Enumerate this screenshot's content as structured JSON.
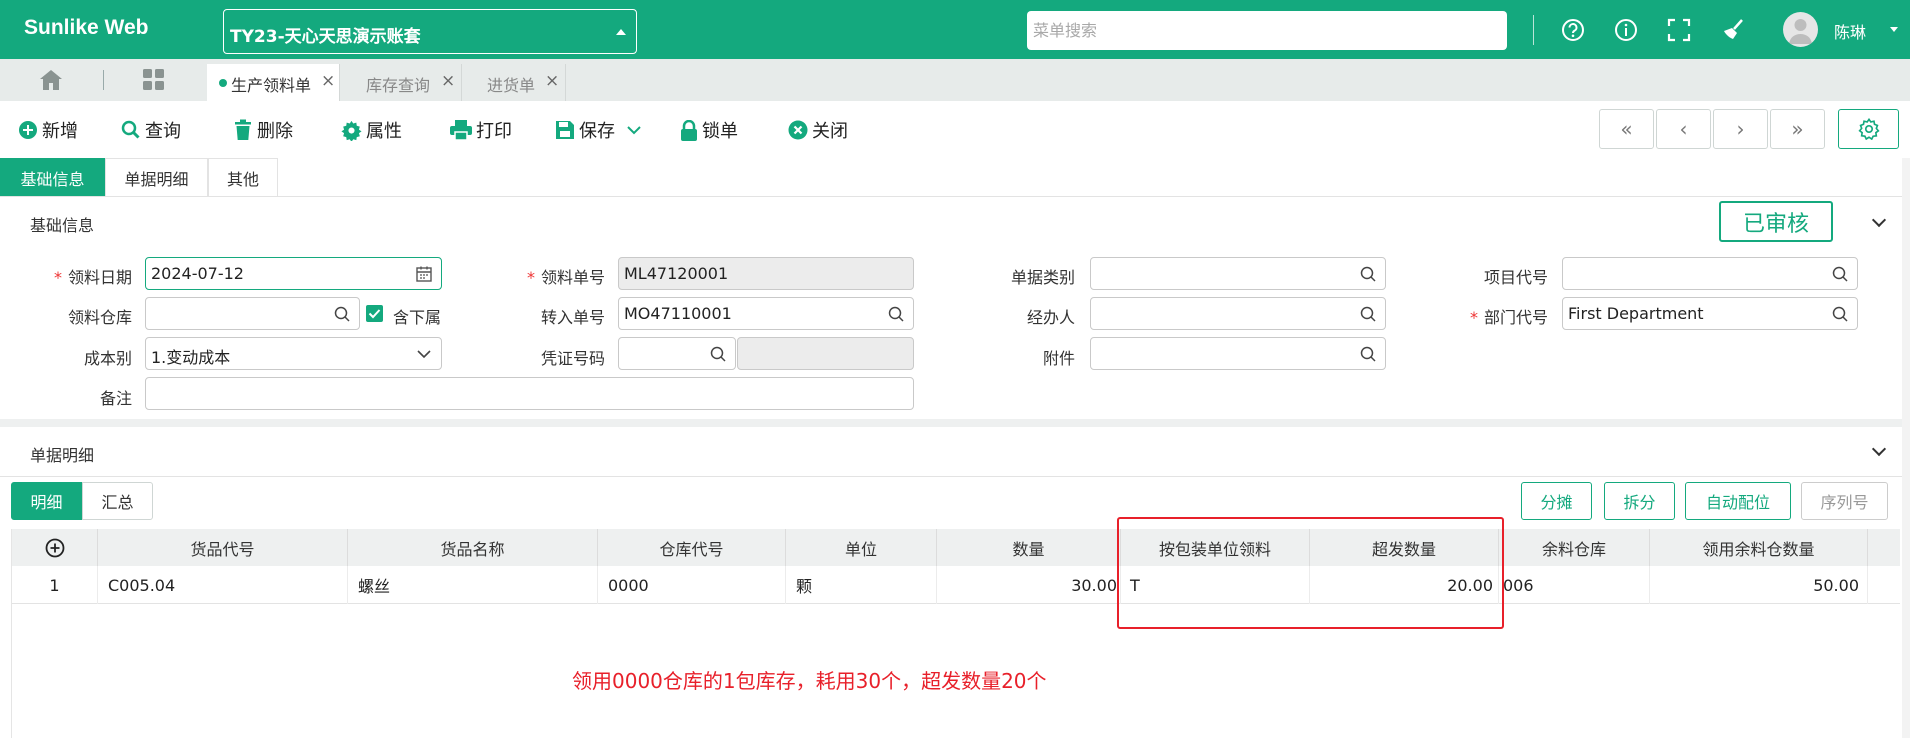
{
  "header": {
    "logo": "Sunlike Web",
    "account": "TY23-天心天思演示账套",
    "search_placeholder": "菜单搜索",
    "user": "陈琳"
  },
  "tabs": [
    {
      "label": "生产领料单",
      "active": true
    },
    {
      "label": "库存查询",
      "active": false
    },
    {
      "label": "进货单",
      "active": false
    }
  ],
  "toolbar": {
    "new": "新增",
    "query": "查询",
    "delete": "删除",
    "properties": "属性",
    "print": "打印",
    "save": "保存",
    "lock": "锁单",
    "close": "关闭"
  },
  "section_tabs": [
    "基础信息",
    "单据明细",
    "其他"
  ],
  "basic": {
    "title": "基础信息",
    "status": "已审核",
    "labels": {
      "issue_date": "领料日期",
      "warehouse": "领料仓库",
      "include_sub": "含下属",
      "cost_type": "成本别",
      "remark": "备注",
      "issue_no": "领料单号",
      "transfer_no": "转入单号",
      "voucher_no": "凭证号码",
      "doc_type": "单据类别",
      "handler": "经办人",
      "attachment": "附件",
      "project_code": "项目代号",
      "dept_code": "部门代号"
    },
    "values": {
      "issue_date": "2024-07-12",
      "cost_type": "1.变动成本",
      "issue_no": "ML47120001",
      "transfer_no": "MO47110001",
      "dept_code": "First Department"
    }
  },
  "detail": {
    "title": "单据明细",
    "sub_tabs": [
      "明细",
      "汇总"
    ],
    "actions": [
      "分摊",
      "拆分",
      "自动配位",
      "序列号"
    ],
    "columns": [
      "货品代号",
      "货品名称",
      "仓库代号",
      "单位",
      "数量",
      "按包装单位领料",
      "超发数量",
      "余料仓库",
      "领用余料仓数量"
    ],
    "rows": [
      {
        "no": "1",
        "code": "C005.04",
        "name": "螺丝",
        "wh": "0000",
        "unit": "颗",
        "qty": "30.00",
        "pack": "T",
        "over": "20.00",
        "rem_wh": "006",
        "rem_qty": "50.00"
      }
    ],
    "annotation": "领用0000仓库的1包库存，耗用30个，超发数量20个"
  }
}
